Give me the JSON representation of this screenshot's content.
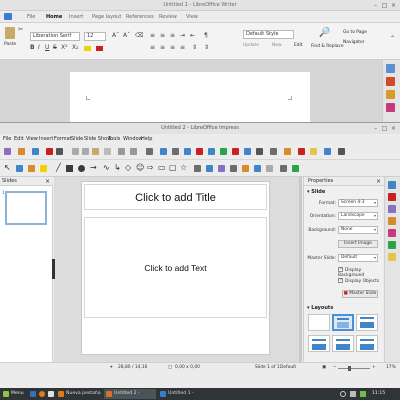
{
  "writer": {
    "title": "Untitled 1 - LibreOffice Writer",
    "tabs": [
      "File",
      "Home",
      "Insert",
      "Page layout",
      "References",
      "Review",
      "View"
    ],
    "active_tab": "Home",
    "font_name": "Liberation Serif",
    "font_size": "12",
    "paragraph_style": "Default Style",
    "paste_label": "Paste",
    "update_label": "Update",
    "new_label": "New",
    "edit_label": "Edit",
    "find_replace_label": "Find & Replace",
    "goto_page_label": "Go to Page",
    "navigator_label": "Navigator"
  },
  "impress": {
    "title": "Untitled 2 - LibreOffice Impress",
    "menu": [
      "File",
      "Edit",
      "View",
      "Insert",
      "Format",
      "Slide",
      "Slide Show",
      "Tools",
      "Window",
      "Help"
    ],
    "slides_panel_title": "Slides",
    "slide_number": "1",
    "title_placeholder": "Click to add Title",
    "content_placeholder": "Click to add Text"
  },
  "properties": {
    "panel_title": "Properties",
    "slide_section": "Slide",
    "format_label": "Format:",
    "format_value": "Screen 4:3",
    "orientation_label": "Orientation:",
    "orientation_value": "Landscape",
    "background_label": "Background:",
    "background_value": "None",
    "insert_image_label": "Insert Image",
    "master_slide_label": "Master Slide:",
    "master_slide_value": "Default",
    "display_background_label": "Display Background",
    "display_objects_label": "Display Objects",
    "master_slides_button": "Master Slide",
    "layouts_section": "Layouts"
  },
  "status": {
    "position": "28,80 / 14,16",
    "size": "0,00 x 0,00",
    "slide_of": "Slide 1 of 1",
    "master": "Default",
    "zoom": "17%"
  },
  "taskbar": {
    "menu_label": "Menu",
    "tasks": [
      "Nueva pestaña - Sh...",
      "Untitled 2 - LibreOffi...",
      "Untitled 1 - LibreOffi..."
    ],
    "clock": "11:15"
  },
  "colors": {
    "accent": "#4a90d9",
    "taskbar": "#2f3437",
    "workspace": "#dcdcdc"
  }
}
